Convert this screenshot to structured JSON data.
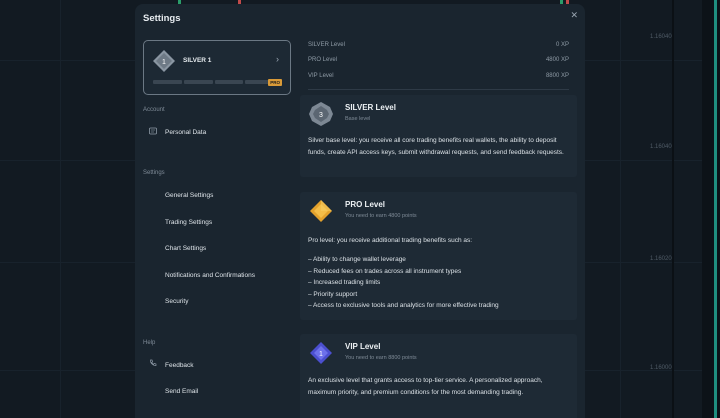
{
  "modal": {
    "title": "Settings",
    "close_icon": "close-icon"
  },
  "level_card": {
    "badge_number": "1",
    "name": "SILVER 1",
    "pro_badge": "PRO"
  },
  "sidebar": {
    "account_label": "Account",
    "account_items": [
      {
        "label": "Personal Data",
        "icon": "id-card-icon"
      }
    ],
    "settings_label": "Settings",
    "settings_items": [
      {
        "label": "General Settings"
      },
      {
        "label": "Trading Settings"
      },
      {
        "label": "Chart Settings"
      },
      {
        "label": "Notifications and Confirmations"
      },
      {
        "label": "Security"
      }
    ],
    "help_label": "Help",
    "help_items": [
      {
        "label": "Feedback",
        "icon": "phone-icon"
      },
      {
        "label": "Send Email"
      }
    ]
  },
  "xp_levels": [
    {
      "name": "SILVER Level",
      "xp": "0 XP"
    },
    {
      "name": "PRO Level",
      "xp": "4800 XP"
    },
    {
      "name": "VIP Level",
      "xp": "8800 XP"
    }
  ],
  "levels": {
    "silver": {
      "badge_number": "3",
      "title": "SILVER Level",
      "subtitle": "Base level",
      "description": "Silver base level: you receive all core trading benefits real wallets, the ability to deposit funds, create API access keys, submit withdrawal requests, and send feedback requests."
    },
    "pro": {
      "title": "PRO Level",
      "subtitle": "You need to earn 4800 points",
      "intro": "Pro level: you receive additional trading benefits such as:",
      "benefits": [
        "– Ability to change wallet leverage",
        "– Reduced fees on trades across all instrument types",
        "– Increased trading limits",
        "– Priority support",
        "– Access to exclusive tools and analytics for more effective trading"
      ]
    },
    "vip": {
      "badge_number": "1",
      "title": "VIP Level",
      "subtitle": "You need to earn 8800 points",
      "description": "An exclusive level that grants access to top-tier service. A personalized approach, maximum priority, and premium conditions for the most demanding trading."
    }
  },
  "chart_axis": {
    "ticks": [
      "1.16040",
      "1.16040",
      "1.16020",
      "1.16000"
    ]
  },
  "colors": {
    "modal_bg": "#1a252f",
    "pro_accent": "#d99a38",
    "vip_accent": "#5b5fe0",
    "axis_accent": "#1f8f80"
  }
}
